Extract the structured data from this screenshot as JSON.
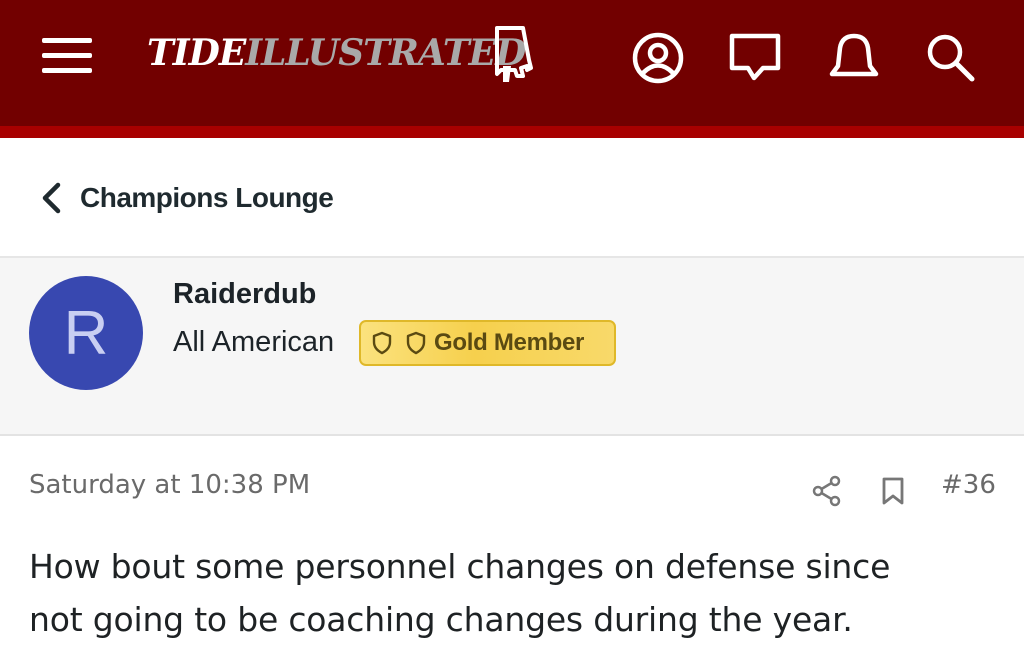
{
  "header": {
    "logo_word_1": "TIDE",
    "logo_word_2": "ILLUSTRATED",
    "icons": [
      "menu-icon",
      "account-icon",
      "messages-icon",
      "alerts-bell-icon",
      "search-icon"
    ],
    "colors": {
      "background": "#720000",
      "stripe": "#a80000"
    }
  },
  "breadcrumb": {
    "label": "Champions Lounge",
    "icon": "chevron-left-icon"
  },
  "author": {
    "avatar_letter": "R",
    "avatar_color": "#3848b0",
    "username": "Raiderdub",
    "title": "All American",
    "badge": {
      "label": "Gold Member",
      "icons": [
        "shield-icon",
        "shield-icon"
      ]
    }
  },
  "post": {
    "date": "Saturday at 10:38 PM",
    "number": "#36",
    "actions": [
      "share-icon",
      "bookmark-icon"
    ],
    "body_line_1": "How bout some personnel changes on defense since",
    "body_line_2": "not going to be coaching changes during the year."
  }
}
